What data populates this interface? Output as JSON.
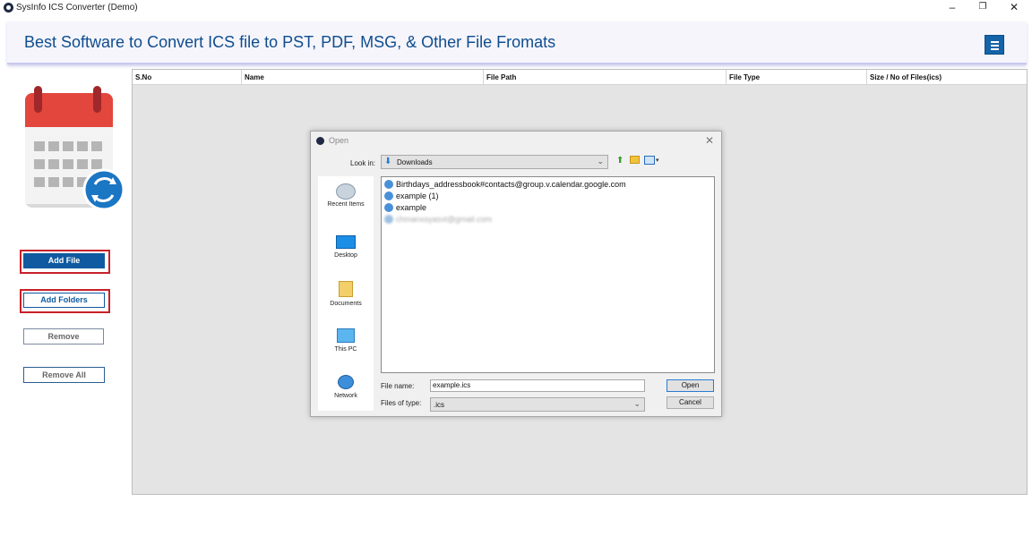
{
  "window": {
    "title": "SysInfo ICS Converter (Demo)",
    "minimize": "–",
    "restore": "❐",
    "close": "✕"
  },
  "header": {
    "title": "Best Software to Convert ICS file to PST, PDF, MSG, & Other File Fromats",
    "accent": "#0f4d8f"
  },
  "sidebar": {
    "add_file": "Add File",
    "add_folders": "Add Folders",
    "remove": "Remove",
    "remove_all": "Remove All"
  },
  "table": {
    "columns": [
      "S.No",
      "Name",
      "File Path",
      "File Type",
      "Size / No of Files(ics)"
    ]
  },
  "dialog": {
    "title": "Open",
    "look_in_label": "Look in:",
    "look_in_value": "Downloads",
    "places": [
      "Recent Items",
      "Desktop",
      "Documents",
      "This PC",
      "Network"
    ],
    "files": [
      "Birthdays_addressbook#contacts@group.v.calendar.google.com",
      "example (1)",
      "example",
      "chmanxsyasvt@gmail.com"
    ],
    "file_name_label": "File name:",
    "file_name_value": "example.ics",
    "file_type_label": "Files of type:",
    "file_type_value": ".ics",
    "open_button": "Open",
    "cancel_button": "Cancel"
  }
}
